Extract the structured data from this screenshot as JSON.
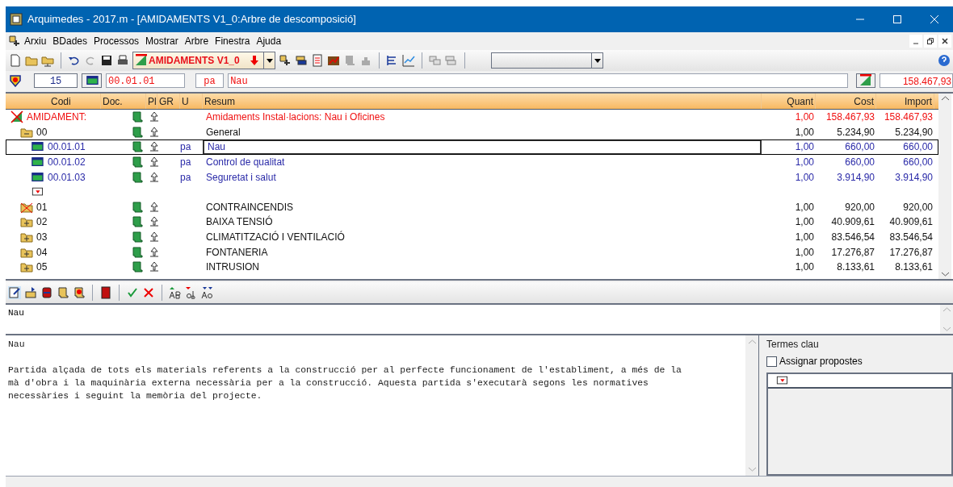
{
  "window": {
    "title": "Arquimedes - 2017.m - [AMIDAMENTS V1_0:Arbre de descomposició]"
  },
  "menu": [
    "Arxiu",
    "BDades",
    "Processos",
    "Mostrar",
    "Arbre",
    "Finestra",
    "Ajuda"
  ],
  "toolbar": {
    "budget": "AMIDAMENTS V1_0"
  },
  "info_bar": {
    "count": "15",
    "code": "00.01.01",
    "unit": "pa",
    "summary": "Nau",
    "total": "158.467,93"
  },
  "table": {
    "columns": [
      "Codi",
      "Doc.",
      "Pl",
      "GR",
      "U",
      "Resum",
      "Quant",
      "Cost",
      "Import"
    ],
    "rows": [
      {
        "kind": "root",
        "code": "AMIDAMENT:",
        "resum": "Amidaments Instal·lacions: Nau i Oficines",
        "quant": "1,00",
        "cost": "158.467,93",
        "import": "158.467,93",
        "selected": false,
        "children": [
          {
            "kind": "chapter_open",
            "code": "00",
            "resum": "General",
            "quant": "1,00",
            "cost": "5.234,90",
            "import": "5.234,90",
            "selected": false,
            "children": [
              {
                "kind": "item",
                "code": "00.01.01",
                "unit": "pa",
                "resum": "Nau",
                "quant": "1,00",
                "cost": "660,00",
                "import": "660,00",
                "selected": true
              },
              {
                "kind": "item",
                "code": "00.01.02",
                "unit": "pa",
                "resum": "Control de qualitat",
                "quant": "1,00",
                "cost": "660,00",
                "import": "660,00",
                "selected": false
              },
              {
                "kind": "item",
                "code": "00.01.03",
                "unit": "pa",
                "resum": "Seguretat i salut",
                "quant": "1,00",
                "cost": "3.914,90",
                "import": "3.914,90",
                "selected": false
              },
              {
                "kind": "new",
                "selected": false
              }
            ]
          },
          {
            "kind": "chapter_crossed",
            "code": "01",
            "resum": "CONTRAINCENDIS",
            "quant": "1,00",
            "cost": "920,00",
            "import": "920,00",
            "selected": false
          },
          {
            "kind": "chapter_closed",
            "code": "02",
            "resum": "BAIXA TENSIÓ",
            "quant": "1,00",
            "cost": "40.909,61",
            "import": "40.909,61",
            "selected": false
          },
          {
            "kind": "chapter_closed",
            "code": "03",
            "resum": "CLIMATITZACIÓ I VENTILACIÓ",
            "quant": "1,00",
            "cost": "83.546,54",
            "import": "83.546,54",
            "selected": false
          },
          {
            "kind": "chapter_closed",
            "code": "04",
            "resum": "FONTANERIA",
            "quant": "1,00",
            "cost": "17.276,87",
            "import": "17.276,87",
            "selected": false
          },
          {
            "kind": "chapter_closed",
            "code": "05",
            "resum": "INTRUSION",
            "quant": "1,00",
            "cost": "8.133,61",
            "import": "8.133,61",
            "selected": false
          }
        ]
      }
    ]
  },
  "editor": {
    "summary": "Nau",
    "description": {
      "heading": "Nau",
      "lines": [
        "Partida alçada de tots els materials referents a la construcció per al perfecte funcionament de l'establiment, a més de la",
        "mà d'obra i la maquinària externa necessària per a la construcció. Aquesta partida s'executarà segons les normatives",
        "necessàries i seguint la memòria del projecte."
      ]
    }
  },
  "keywords": {
    "title": "Termes clau",
    "assign": {
      "label": "Assignar propostes",
      "checked": false
    }
  }
}
